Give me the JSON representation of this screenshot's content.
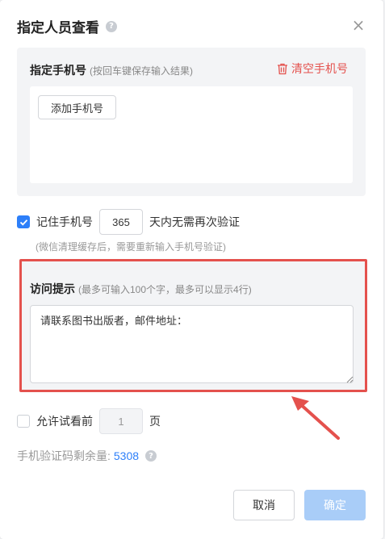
{
  "dialog": {
    "title": "指定人员查看",
    "help_icon": "question-icon",
    "close_icon": "close-icon",
    "close_glyph": "×"
  },
  "phone": {
    "label": "指定手机号",
    "hint": "(按回车键保存输入结果)",
    "clear_label": "清空手机号",
    "clear_icon": "trash-icon",
    "add_label": "添加手机号"
  },
  "remember": {
    "checked": true,
    "label": "记住手机号",
    "days": "365",
    "suffix": "天内无需再次验证",
    "note": "(微信清理缓存后，需要重新输入手机号验证)"
  },
  "notice": {
    "label": "访问提示",
    "hint": "(最多可输入100个字，最多可以显示4行)",
    "text": "请联系图书出版者，邮件地址："
  },
  "preview": {
    "checked": false,
    "label": "允许试看前",
    "pages": "1",
    "suffix": "页"
  },
  "quota": {
    "label": "手机验证码剩余量:",
    "value": "5308"
  },
  "footer": {
    "cancel": "取消",
    "confirm": "确定"
  },
  "colors": {
    "accent": "#2d7ff9",
    "danger": "#e4514d",
    "confirm_disabled": "#a9cdf8"
  }
}
